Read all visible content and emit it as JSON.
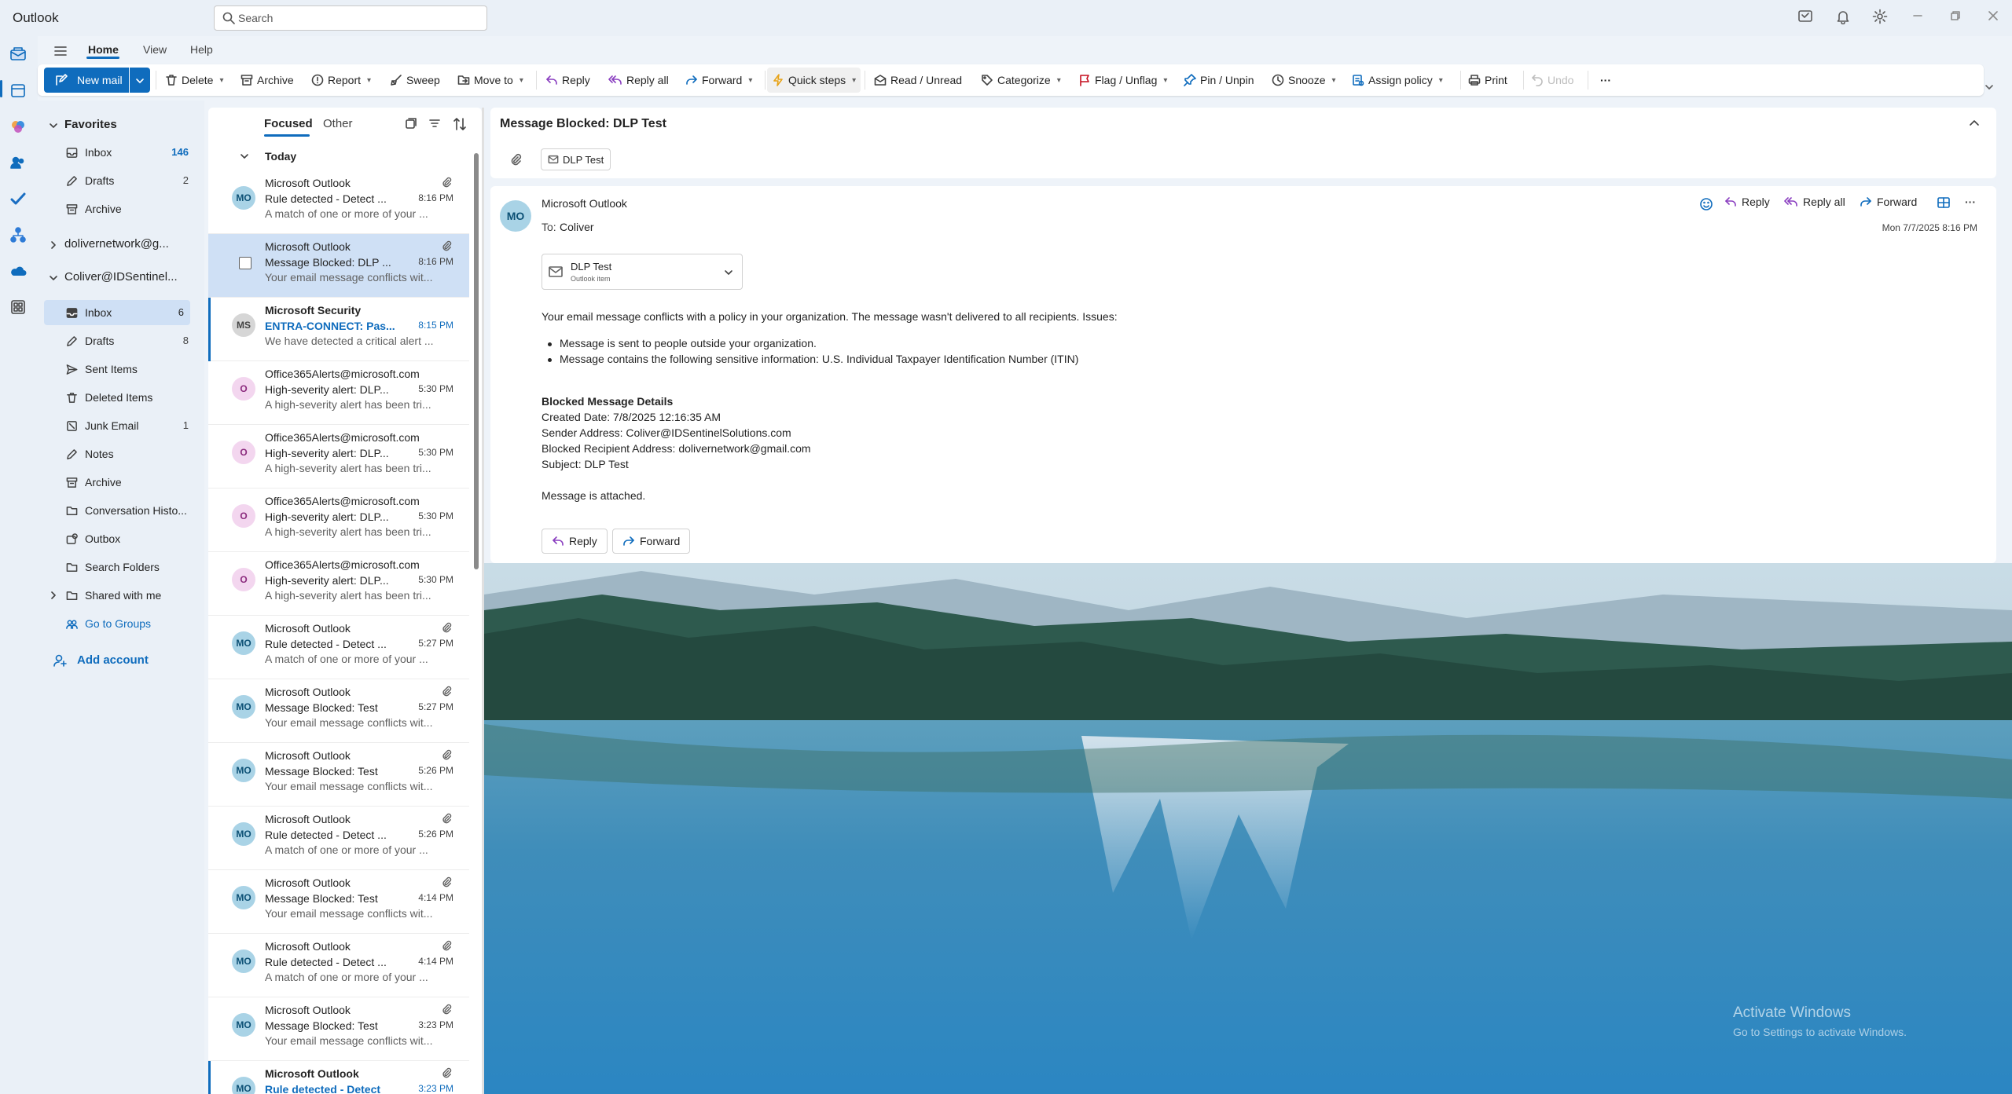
{
  "app": {
    "title": "Outlook"
  },
  "search": {
    "placeholder": "Search"
  },
  "ribbon_tabs": [
    "Home",
    "View",
    "Help"
  ],
  "ribbon": {
    "new_mail": "New mail",
    "delete": "Delete",
    "archive": "Archive",
    "report": "Report",
    "sweep": "Sweep",
    "move_to": "Move to",
    "reply": "Reply",
    "reply_all": "Reply all",
    "forward": "Forward",
    "quick_steps": "Quick steps",
    "read_unread": "Read / Unread",
    "categorize": "Categorize",
    "flag_unflag": "Flag / Unflag",
    "pin_unpin": "Pin / Unpin",
    "snooze": "Snooze",
    "assign_policy": "Assign policy",
    "print": "Print",
    "undo": "Undo",
    "more": "···"
  },
  "folders": {
    "favorites_header": "Favorites",
    "favorites": [
      {
        "name": "Inbox",
        "count": "146"
      },
      {
        "name": "Drafts",
        "count": "2"
      },
      {
        "name": "Archive",
        "count": ""
      }
    ],
    "account1": "dolivernetwork@g...",
    "account2": "Coliver@IDSentinel...",
    "items": [
      {
        "name": "Inbox",
        "count": "6"
      },
      {
        "name": "Drafts",
        "count": "8"
      },
      {
        "name": "Sent Items",
        "count": ""
      },
      {
        "name": "Deleted Items",
        "count": ""
      },
      {
        "name": "Junk Email",
        "count": "1"
      },
      {
        "name": "Notes",
        "count": ""
      },
      {
        "name": "Archive",
        "count": ""
      },
      {
        "name": "Conversation Histo...",
        "count": ""
      },
      {
        "name": "Outbox",
        "count": ""
      },
      {
        "name": "Search Folders",
        "count": ""
      },
      {
        "name": "Shared with me",
        "count": ""
      },
      {
        "name": "Go to Groups",
        "count": ""
      }
    ],
    "add_account": "Add account"
  },
  "list": {
    "tab_focused": "Focused",
    "tab_other": "Other",
    "group_today": "Today",
    "messages": [
      {
        "initials": "MO",
        "sender": "Microsoft Outlook",
        "subject": "Rule detected - Detect ...",
        "time": "8:16 PM",
        "preview": "A match of one or more of your ..."
      },
      {
        "initials": "MO",
        "sender": "Microsoft Outlook",
        "subject": "Message Blocked: DLP ...",
        "time": "8:16 PM",
        "preview": "Your email message conflicts wit..."
      },
      {
        "initials": "MS",
        "sender": "Microsoft Security",
        "subject": "ENTRA-CONNECT: Pas...",
        "time": "8:15 PM",
        "preview": "We have detected a critical alert ..."
      },
      {
        "initials": "O",
        "sender": "Office365Alerts@microsoft.com",
        "subject": "High-severity alert: DLP...",
        "time": "5:30 PM",
        "preview": "A high-severity alert has been tri..."
      },
      {
        "initials": "O",
        "sender": "Office365Alerts@microsoft.com",
        "subject": "High-severity alert: DLP...",
        "time": "5:30 PM",
        "preview": "A high-severity alert has been tri..."
      },
      {
        "initials": "O",
        "sender": "Office365Alerts@microsoft.com",
        "subject": "High-severity alert: DLP...",
        "time": "5:30 PM",
        "preview": "A high-severity alert has been tri..."
      },
      {
        "initials": "O",
        "sender": "Office365Alerts@microsoft.com",
        "subject": "High-severity alert: DLP...",
        "time": "5:30 PM",
        "preview": "A high-severity alert has been tri..."
      },
      {
        "initials": "MO",
        "sender": "Microsoft Outlook",
        "subject": "Rule detected - Detect ...",
        "time": "5:27 PM",
        "preview": "A match of one or more of your ..."
      },
      {
        "initials": "MO",
        "sender": "Microsoft Outlook",
        "subject": "Message Blocked: Test",
        "time": "5:27 PM",
        "preview": "Your email message conflicts wit..."
      },
      {
        "initials": "MO",
        "sender": "Microsoft Outlook",
        "subject": "Message Blocked: Test",
        "time": "5:26 PM",
        "preview": "Your email message conflicts wit..."
      },
      {
        "initials": "MO",
        "sender": "Microsoft Outlook",
        "subject": "Rule detected - Detect ...",
        "time": "5:26 PM",
        "preview": "A match of one or more of your ..."
      },
      {
        "initials": "MO",
        "sender": "Microsoft Outlook",
        "subject": "Message Blocked: Test",
        "time": "4:14 PM",
        "preview": "Your email message conflicts wit..."
      },
      {
        "initials": "MO",
        "sender": "Microsoft Outlook",
        "subject": "Rule detected - Detect ...",
        "time": "4:14 PM",
        "preview": "A match of one or more of your ..."
      },
      {
        "initials": "MO",
        "sender": "Microsoft Outlook",
        "subject": "Message Blocked: Test",
        "time": "3:23 PM",
        "preview": "Your email message conflicts wit..."
      },
      {
        "initials": "MO",
        "sender": "Microsoft Outlook",
        "subject": "Rule detected - Detect",
        "time": "3:23 PM",
        "preview": ""
      }
    ]
  },
  "reading": {
    "subject": "Message Blocked: DLP Test",
    "tag": "DLP Test",
    "sender_initials": "MO",
    "from": "Microsoft Outlook",
    "to_label": "To:",
    "to": "Coliver",
    "reply": "Reply",
    "reply_all": "Reply all",
    "forward": "Forward",
    "date": "Mon 7/7/2025 8:16 PM",
    "attachment_name": "DLP Test",
    "attachment_type": "Outlook item",
    "intro": "Your email message conflicts with a policy in your organization. The message wasn't delivered to all recipients. Issues:",
    "issues": [
      "Message is sent to people outside your organization.",
      "Message contains the following sensitive information: U.S. Individual Taxpayer Identification Number (ITIN)"
    ],
    "details_title": "Blocked Message Details",
    "details": [
      "Created Date: 7/8/2025 12:16:35 AM",
      "Sender Address: Coliver@IDSentinelSolutions.com",
      "Blocked Recipient Address: dolivernetwork@gmail.com",
      "Subject: DLP Test"
    ],
    "attached_note": "Message is attached.",
    "btn_reply": "Reply",
    "btn_forward": "Forward"
  },
  "watermark": {
    "line1": "Activate Windows",
    "line2": "Go to Settings to activate Windows."
  },
  "colors": {
    "accent": "#0f6cbd",
    "chrome": "#eaf0f7",
    "selected": "#cfe0f5"
  }
}
